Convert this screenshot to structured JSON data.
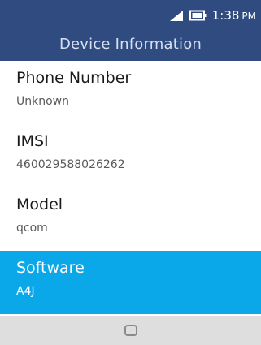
{
  "status_bar": {
    "time": "1:38",
    "ampm": "PM",
    "icons": [
      "signal-icon",
      "battery-icon"
    ]
  },
  "header": {
    "title": "Device Information"
  },
  "items": [
    {
      "label": "Phone Number",
      "value": "Unknown"
    },
    {
      "label": "IMSI",
      "value": "460029588026262"
    },
    {
      "label": "Model",
      "value": "qcom"
    },
    {
      "label": "Software",
      "value": "A4J"
    }
  ],
  "selected_index": 3,
  "softkeys": {
    "center_icon": "center-softkey-icon"
  },
  "colors": {
    "header_bg": "#2f4b80",
    "selected_bg": "#0aa8e8",
    "softkey_bar_bg": "#dedede"
  }
}
